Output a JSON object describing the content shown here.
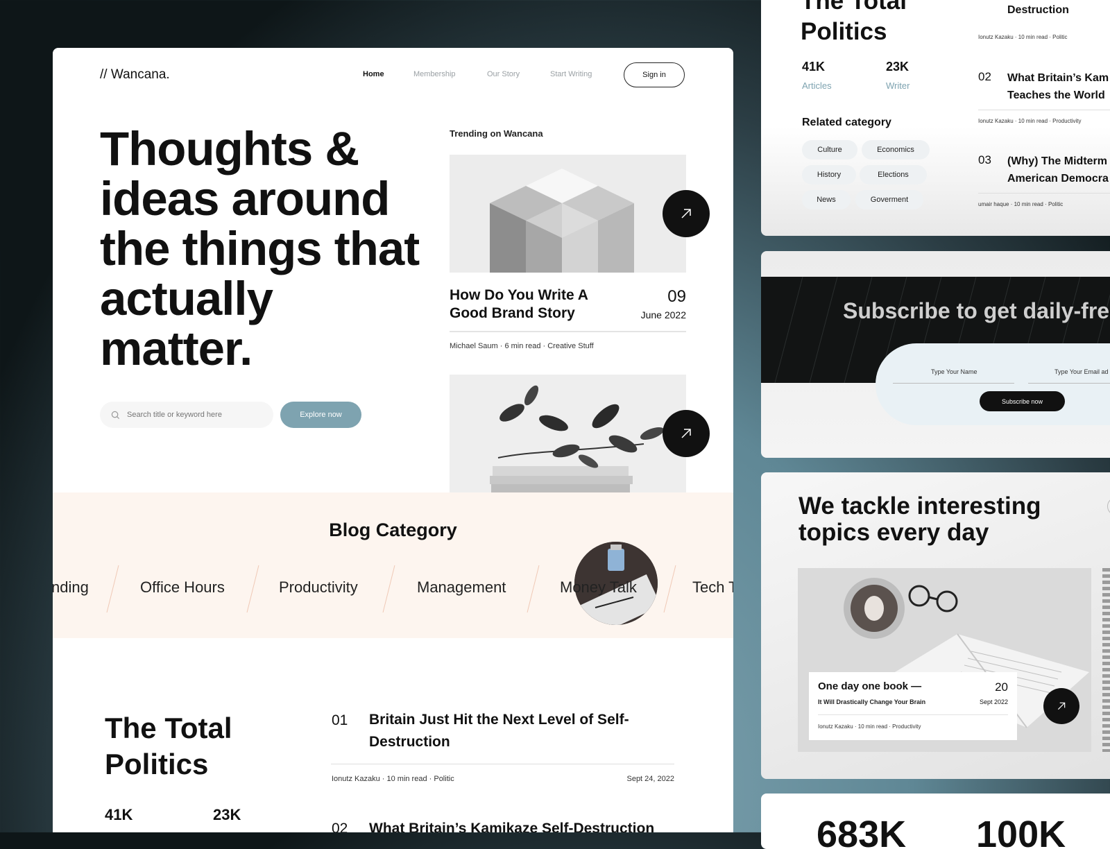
{
  "brand": "// Wancana.",
  "nav": {
    "items": [
      "Home",
      "Membership",
      "Our Story",
      "Start Writing"
    ],
    "signin": "Sign in"
  },
  "hero": {
    "title": "Thoughts & ideas around the things that actually matter.",
    "search_placeholder": "Search title or keyword here",
    "cta": "Explore now"
  },
  "trending": {
    "heading": "Trending on Wancana",
    "post": {
      "title": "How Do You Write A Good Brand Story",
      "day": "09",
      "month": "June 2022",
      "meta": "Michael Saum · 6 min read · Creative Stuff"
    }
  },
  "blog_category": {
    "title": "Blog Category",
    "items": [
      "nding",
      "Office Hours",
      "Productivity",
      "Management",
      "Money Talk",
      "Tech T"
    ]
  },
  "politics": {
    "title": "The Total Politics",
    "stats": [
      {
        "value": "41K",
        "label": "Articles"
      },
      {
        "value": "23K",
        "label": "Writer"
      }
    ],
    "articles": [
      {
        "num": "01",
        "title": "Britain Just Hit the Next Level of Self-Destruction",
        "meta": "Ionutz Kazaku · 10 min read · Politic",
        "date": "Sept 24, 2022"
      },
      {
        "num": "02",
        "title": "What Britain’s Kamikaze Self-Destruction"
      }
    ]
  },
  "panel_politics": {
    "title_line1": "The Total",
    "title_line2": "Politics",
    "stats": [
      {
        "value": "41K",
        "label": "Articles"
      },
      {
        "value": "23K",
        "label": "Writer"
      }
    ],
    "related_heading": "Related category",
    "chips": [
      "Culture",
      "Economics",
      "History",
      "Elections",
      "News",
      "Goverment"
    ],
    "list": [
      {
        "num": "",
        "title": "Destruction",
        "meta": "Ionutz Kazaku · 10 min read · Politic"
      },
      {
        "num": "02",
        "title_line1": "What Britain’s Kam",
        "title_line2": "Teaches the World",
        "meta": "Ionutz Kazaku · 10 min read · Productivity"
      },
      {
        "num": "03",
        "title_line1": "(Why) The Midterm",
        "title_line2": "American Democra",
        "meta": "umair haque · 10 min read · Politic"
      }
    ]
  },
  "subscribe": {
    "title": "Subscribe to get daily-fre",
    "name_label": "Type Your Name",
    "email_label": "Type Your Email ad",
    "button": "Subscribe now"
  },
  "topics": {
    "title": "We tackle interesting topics every day",
    "card": {
      "title": "One day one book —",
      "subtitle": "It Will Drastically Change Your Brain",
      "day": "20",
      "month": "Sept 2022",
      "meta": "Ionutz Kazaku · 10 min read · Productivity"
    }
  },
  "bottom_stats": [
    "683K",
    "100K"
  ],
  "colors": {
    "accent": "#7ea3b0",
    "dark": "#111111",
    "category_bg": "#fdf5ef",
    "chip_bg": "#eef1f3"
  }
}
